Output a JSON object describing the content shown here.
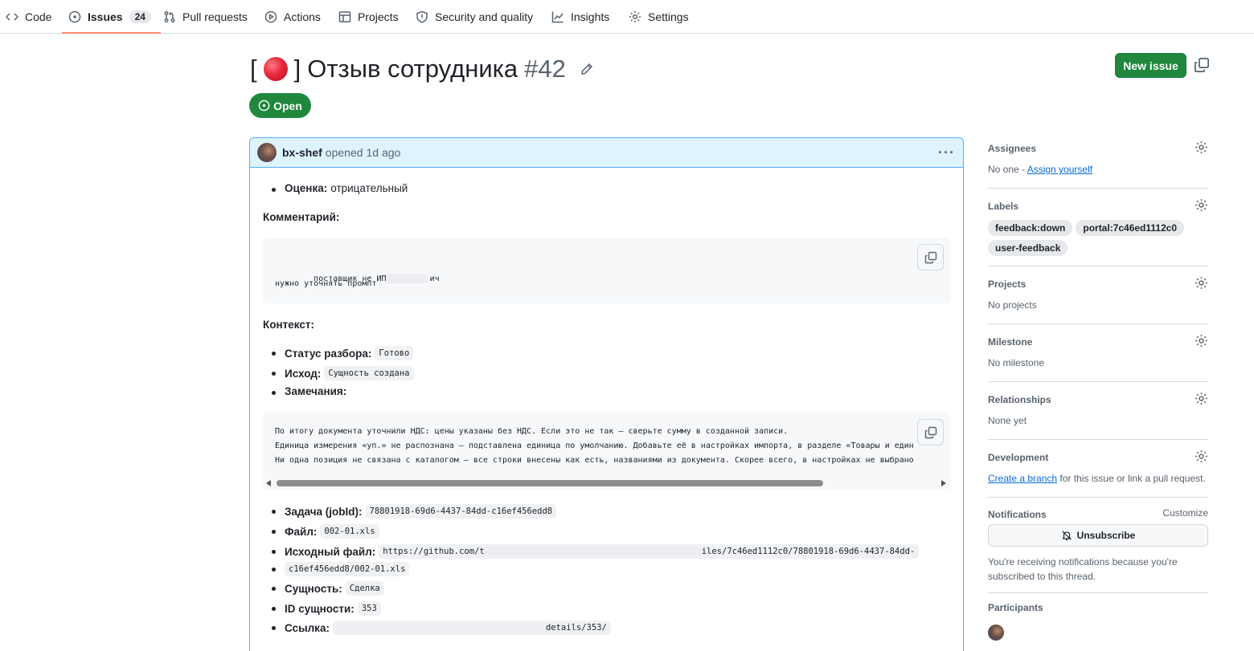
{
  "nav": {
    "tabs": [
      {
        "label": "Code",
        "icon": "code-icon"
      },
      {
        "label": "Issues",
        "icon": "issue-opened-icon",
        "count": "24"
      },
      {
        "label": "Pull requests",
        "icon": "git-pull-request-icon"
      },
      {
        "label": "Actions",
        "icon": "play-icon"
      },
      {
        "label": "Projects",
        "icon": "table-icon"
      },
      {
        "label": "Security and quality",
        "icon": "shield-icon"
      },
      {
        "label": "Insights",
        "icon": "graph-icon"
      },
      {
        "label": "Settings",
        "icon": "gear-icon"
      }
    ],
    "active_tab": "Issues"
  },
  "issue": {
    "title_prefix": "[",
    "title_suffix": "]",
    "title": "Отзыв сотрудника",
    "number": "#42",
    "state": "Open",
    "new_issue_label": "New issue"
  },
  "comment": {
    "author": "bx-shef",
    "action": "opened",
    "time": "1d ago",
    "rating_label": "Оценка:",
    "rating_value": "отрицательный",
    "comment_head": "Комментарий:",
    "comment_code_line1_a": "поставщик не ИП",
    "comment_code_line1_b": "ич",
    "comment_code_line2": "нужно уточнять промпт",
    "context_head": "Контекст:",
    "status_label": "Статус разбора:",
    "status_value": "Готово",
    "outcome_label": "Исход:",
    "outcome_value": "Сущность создана",
    "notes_label": "Замечания:",
    "notes_line1": "По итогу документа уточнили НДС: цены указаны без НДС. Если это не так — сверьте сумму в созданной записи.",
    "notes_line2": "Единица измерения «уп.» не распознана — подставлена единица по умолчанию. Добавьте её в настройках импорта, в разделе «Товары и един",
    "notes_line3": "Ни одна позиция не связана с каталогом — все строки внесены как есть, названиями из документа. Скорее всего, в настройках не выбрано",
    "job_label": "Задача (jobId):",
    "job_value": "78801918-69d6-4437-84dd-c16ef456edd8",
    "file_label": "Файл:",
    "file_value": "002-01.xls",
    "source_label": "Исходный файл:",
    "source_value_a": "https://github.com/t",
    "source_value_b": "iles/7c46ed1112c0/78801918-69d6-4437-84dd-",
    "source_value_c": "c16ef456edd8/002-01.xls",
    "entity_label": "Сущность:",
    "entity_value": "Сделка",
    "entity_id_label": "ID сущности:",
    "entity_id_value": "353",
    "link_label": "Ссылка:",
    "link_value": "details/353/"
  },
  "sidebar": {
    "assignees_title": "Assignees",
    "assignees_none": "No one -",
    "assign_yourself": "Assign yourself",
    "labels_title": "Labels",
    "labels": [
      "feedback:down",
      "portal:7c46ed1112c0",
      "user-feedback"
    ],
    "projects_title": "Projects",
    "projects_none": "No projects",
    "milestone_title": "Milestone",
    "milestone_none": "No milestone",
    "relationships_title": "Relationships",
    "relationships_none": "None yet",
    "development_title": "Development",
    "create_branch": "Create a branch",
    "development_rest": "for this issue or link a pull request.",
    "notifications_title": "Notifications",
    "customize": "Customize",
    "unsubscribe": "Unsubscribe",
    "notifications_note_1": "You're receiving notifications because you're",
    "notifications_note_2": "subscribed to this thread.",
    "participants_title": "Participants"
  },
  "colors": {
    "accent_green": "#1f883d",
    "link_blue": "#0969da",
    "tab_underline": "#fd8c73",
    "comment_header_bg": "#ddf4ff"
  }
}
